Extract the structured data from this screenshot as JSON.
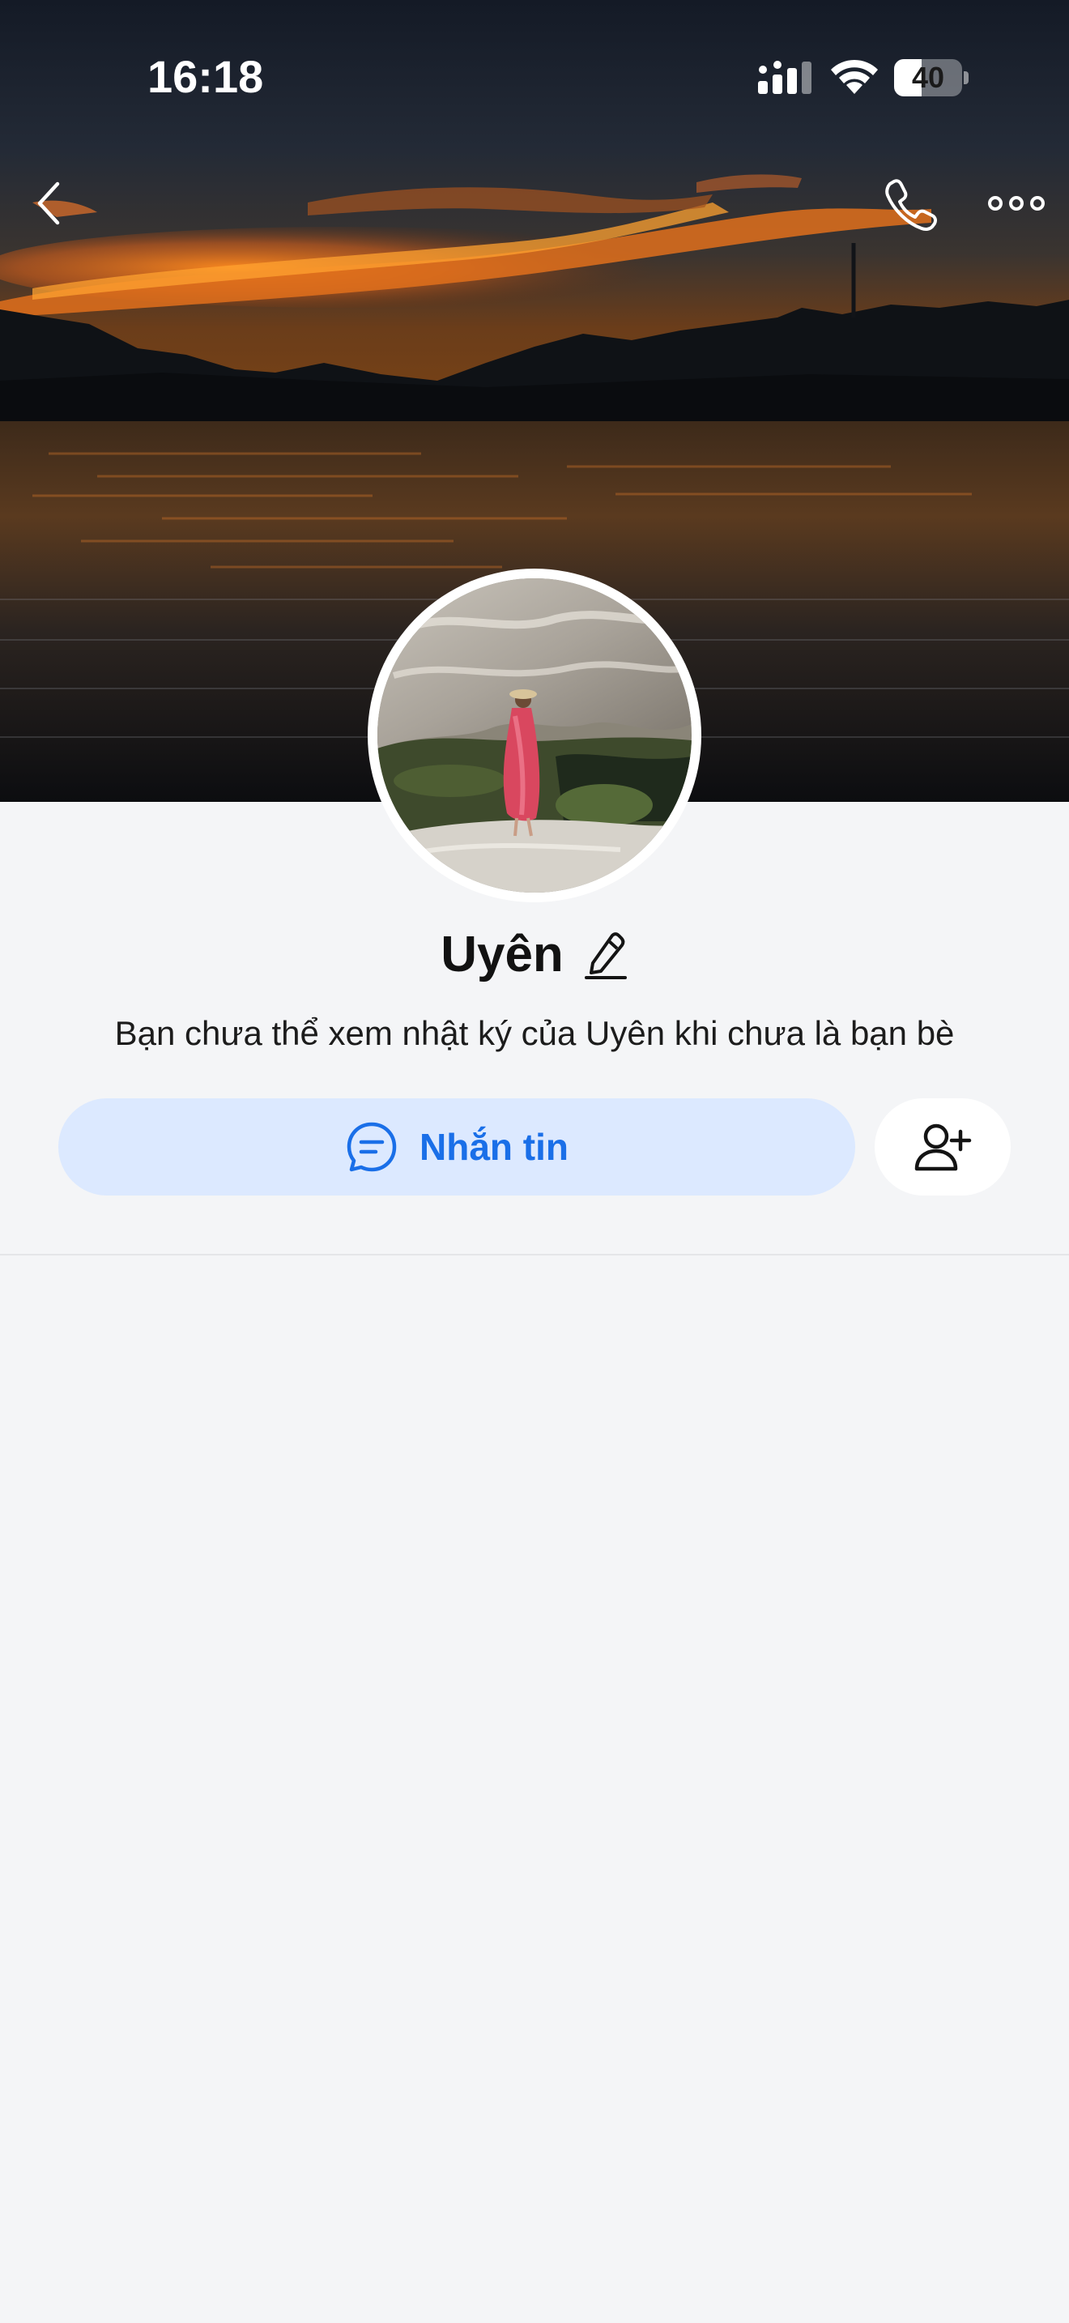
{
  "status_bar": {
    "time": "16:18",
    "battery_level": "40",
    "battery_fraction": 0.4,
    "icons": [
      "signal-icon",
      "wifi-icon",
      "battery-icon"
    ]
  },
  "nav": {
    "icons": [
      "chevron-left-icon",
      "phone-icon",
      "more-horizontal-icon"
    ]
  },
  "profile": {
    "name": "Uyên",
    "privacy_note": "Bạn chưa thể xem nhật ký của Uyên khi chưa là bạn bè"
  },
  "actions": {
    "message_label": "Nhắn tin",
    "message_icon": "chat-bubble-icon",
    "add_friend_icon": "user-plus-icon"
  },
  "colors": {
    "accent": "#1a6fe8",
    "message_button_bg": "#dce9ff",
    "page_bg": "#f4f5f7"
  }
}
